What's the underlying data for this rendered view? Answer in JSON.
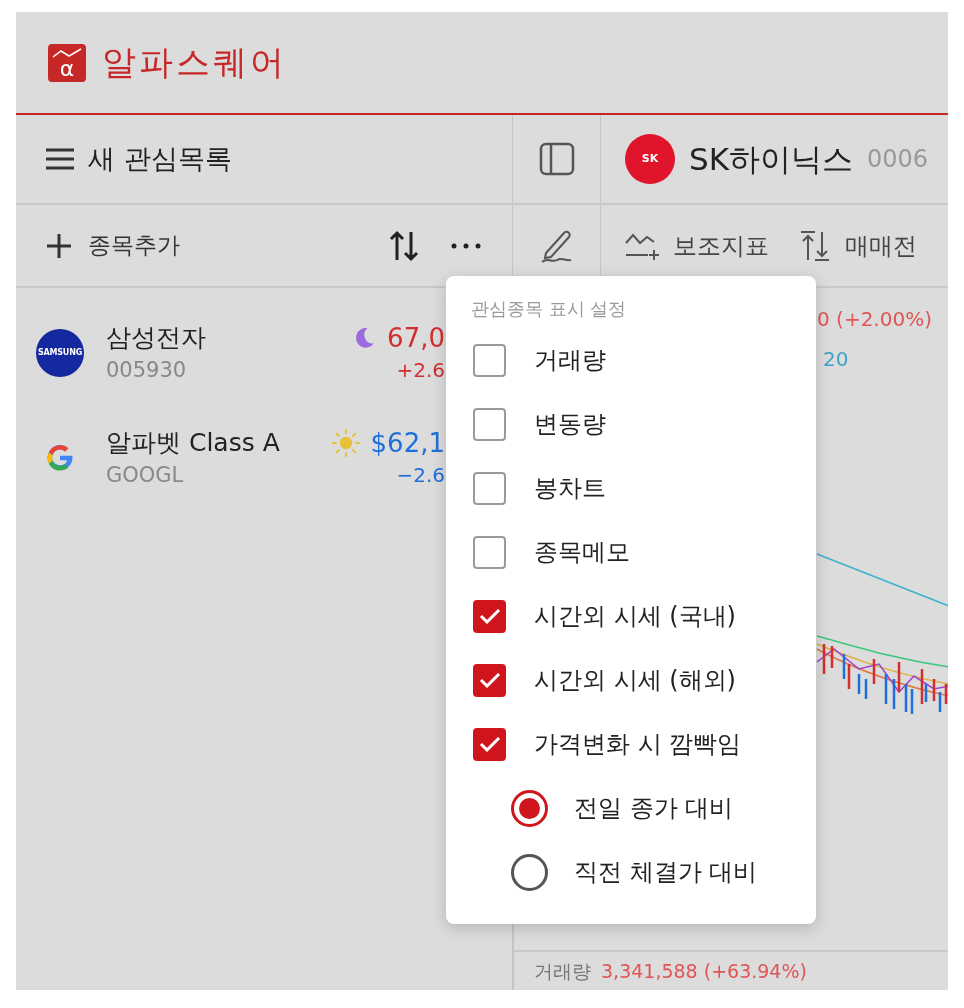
{
  "app": {
    "logo_mark": "α",
    "title": "알파스퀘어"
  },
  "watchlist": {
    "title": "새 관심목록",
    "add_label": "종목추가",
    "items": [
      {
        "logo": {
          "kind": "samsung",
          "text": "SAMSUNG"
        },
        "name": "삼성전자",
        "code": "005930",
        "session": {
          "kind": "night"
        },
        "price": "67,0",
        "change": "+2.6",
        "color": "#d32f2f"
      },
      {
        "logo": {
          "kind": "google"
        },
        "name": "알파벳 Class A",
        "code": "GOOGL",
        "session": {
          "kind": "day"
        },
        "price": "$62,1",
        "change": "−2.6",
        "color": "#1e6fd9"
      }
    ]
  },
  "stock": {
    "logo_text": "SK",
    "name": "SK하이닉스",
    "code": "0006"
  },
  "toolbar": [
    {
      "kind": "indicator",
      "label": "보조지표"
    },
    {
      "kind": "trade",
      "label": "매매전"
    }
  ],
  "quote": {
    "change": "0 (+2.00%)",
    "line_2": "20"
  },
  "volume": {
    "label": "거래량",
    "value": "3,341,588 (+63.94%)"
  },
  "menu": {
    "title": "관심종목 표시 설정",
    "options": [
      {
        "kind": "checkbox",
        "label": "거래량",
        "checked": false
      },
      {
        "kind": "checkbox",
        "label": "변동량",
        "checked": false
      },
      {
        "kind": "checkbox",
        "label": "봉차트",
        "checked": false
      },
      {
        "kind": "checkbox",
        "label": "종목메모",
        "checked": false
      },
      {
        "kind": "checkbox",
        "label": "시간외 시세 (국내)",
        "checked": true
      },
      {
        "kind": "checkbox",
        "label": "시간외 시세 (해외)",
        "checked": true
      },
      {
        "kind": "checkbox",
        "label": "가격변화 시 깜빡임",
        "checked": true
      },
      {
        "kind": "radio",
        "label": "전일 종가 대비",
        "selected": true
      },
      {
        "kind": "radio",
        "label": "직전 체결가 대비",
        "selected": false
      }
    ]
  }
}
